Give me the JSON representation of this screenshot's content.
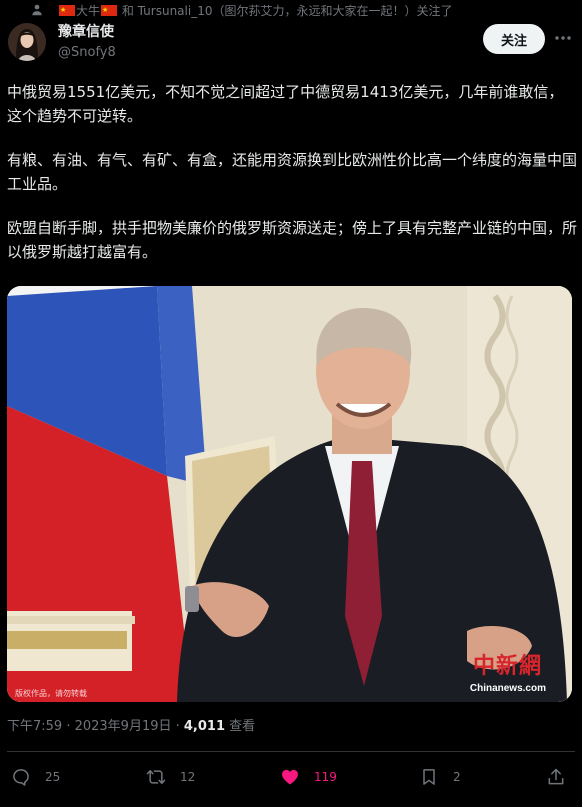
{
  "context": {
    "text_a": "大牛",
    "text_b": "和 Tursunali_10（图尔荪艾力，永远和大家在一起！）关注了",
    "icons": [
      "person-icon",
      "china-flag-icon",
      "china-flag-icon"
    ]
  },
  "author": {
    "name": "豫章信使",
    "handle": "@Snofy8"
  },
  "follow_label": "关注",
  "tweet": {
    "paragraphs": [
      "中俄贸易1551亿美元，不知不觉之间超过了中德贸易1413亿美元，几年前谁敢信，这个趋势不可逆转。",
      "有粮、有油、有气、有矿、有盒，还能用资源换到比欧洲性价比高一个纬度的海量中国工业品。",
      "欧盟自断手脚，拱手把物美廉价的俄罗斯资源送走；傍上了具有完整产业链的中国，所以俄罗斯越打越富有。"
    ]
  },
  "media": {
    "watermark_logo": "中新網",
    "watermark_site": "Chinanews.com",
    "copyright": "版权作品，请勿转载"
  },
  "meta": {
    "timestamp": "下午7:59 · 2023年9月19日 · ",
    "views_count": "4,011",
    "views_label": " 查看"
  },
  "actions": {
    "reply_count": "25",
    "retweet_count": "12",
    "like_count": "119",
    "bookmark_count": "2"
  },
  "colors": {
    "background": "#000000",
    "text": "#e7e9ea",
    "secondary": "#71767b",
    "like": "#f91880",
    "divider": "#2f3336"
  }
}
